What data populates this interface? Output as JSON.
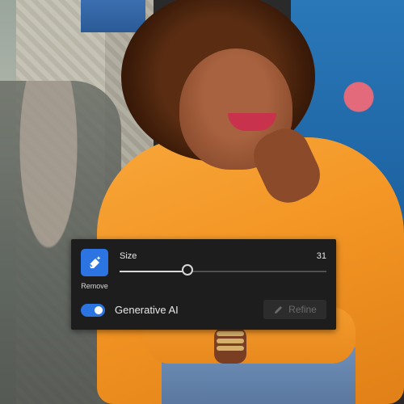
{
  "tool": {
    "label": "Remove",
    "icon": "eraser-sparkle-icon",
    "accent": "#2b74e2"
  },
  "size": {
    "label": "Size",
    "value": "31",
    "level": 0.32
  },
  "generative_ai": {
    "label": "Generative AI",
    "enabled": true
  },
  "refine": {
    "label": "Refine",
    "icon": "pencil-icon",
    "disabled": true
  }
}
